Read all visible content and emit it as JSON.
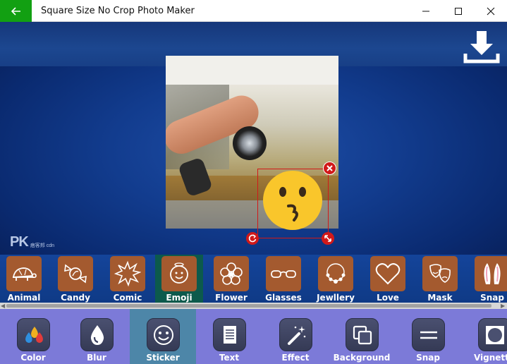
{
  "window": {
    "title": "Square Size No Crop Photo Maker",
    "back_icon": "arrow-left-icon",
    "controls": [
      "minimize-icon",
      "maximize-icon",
      "close-icon"
    ]
  },
  "canvas": {
    "download_icon": "download-icon",
    "watermark": {
      "logo": "PK",
      "text": "痞客邦 cdn"
    },
    "sticker": {
      "emoji": "kissing-face",
      "controls": [
        "delete-icon",
        "rotate-icon",
        "resize-icon"
      ]
    }
  },
  "categories": [
    {
      "label": "Animal",
      "icon": "turtle-icon"
    },
    {
      "label": "Candy",
      "icon": "candy-icon"
    },
    {
      "label": "Comic",
      "icon": "burst-icon"
    },
    {
      "label": "Emoji",
      "icon": "smiley-icon",
      "selected": true
    },
    {
      "label": "Flower",
      "icon": "flower-icon"
    },
    {
      "label": "Glasses",
      "icon": "glasses-icon"
    },
    {
      "label": "Jewllery",
      "icon": "necklace-icon"
    },
    {
      "label": "Love",
      "icon": "heart-icon"
    },
    {
      "label": "Mask",
      "icon": "theater-mask-icon"
    },
    {
      "label": "Snap",
      "icon": "bunny-ears-icon"
    }
  ],
  "tools": [
    {
      "label": "Color",
      "icon": "color-drops-icon"
    },
    {
      "label": "Blur",
      "icon": "drop-icon"
    },
    {
      "label": "Sticker",
      "icon": "smiley-icon",
      "selected": true
    },
    {
      "label": "Text",
      "icon": "document-icon"
    },
    {
      "label": "Effect",
      "icon": "magic-wand-icon"
    },
    {
      "label": "Background",
      "icon": "layers-icon"
    },
    {
      "label": "Snap",
      "icon": "equals-icon"
    },
    {
      "label": "Vignette",
      "icon": "vignette-icon"
    }
  ],
  "colors": {
    "back_button": "#12a012",
    "category_tile": "#a45a2f",
    "category_selected": "#0c5a4c",
    "toolbar": "#7c7ad8",
    "tool_selected": "#4d86a8",
    "sticker_frame": "#d11919"
  }
}
